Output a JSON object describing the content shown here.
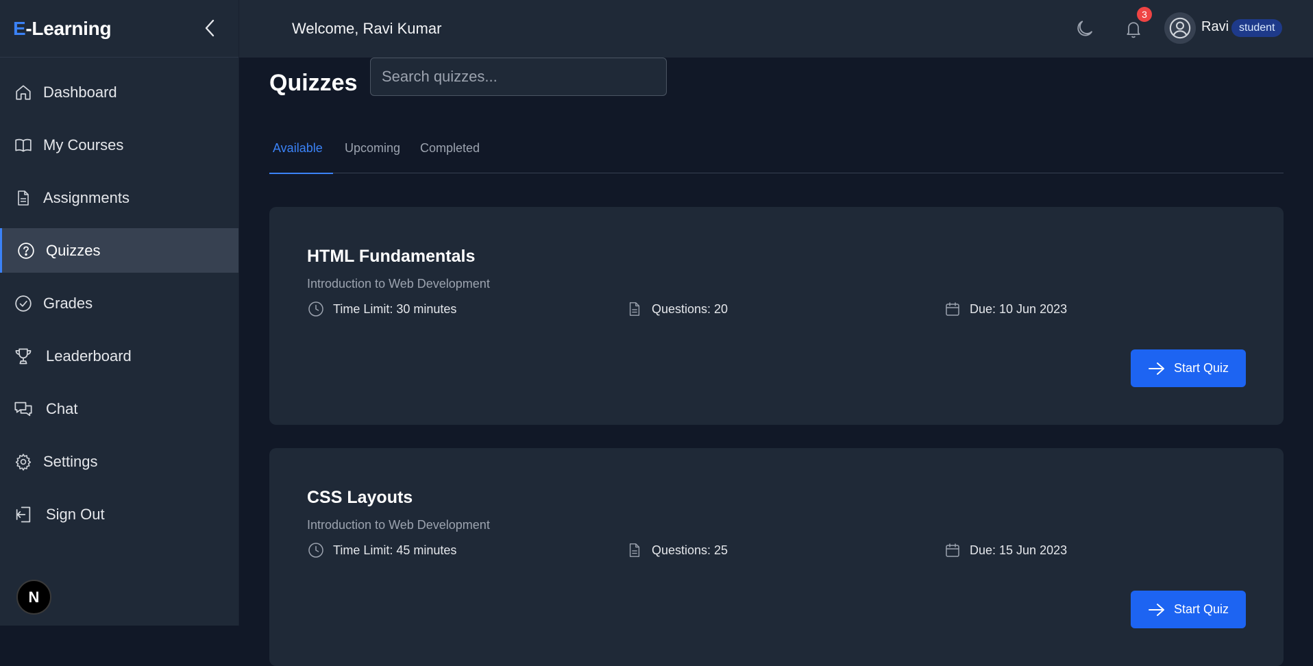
{
  "app": {
    "logo_accent": "E",
    "logo_rest": "-Learning",
    "accent_color": "#3b82f6"
  },
  "header": {
    "welcome": "Welcome, Ravi Kumar",
    "notification_count": "3",
    "username": "Ravi",
    "role": "student"
  },
  "sidebar": {
    "items": [
      {
        "label": "Dashboard",
        "icon": "home-icon"
      },
      {
        "label": "My Courses",
        "icon": "book-icon"
      },
      {
        "label": "Assignments",
        "icon": "document-icon"
      },
      {
        "label": "Quizzes",
        "icon": "question-circle-icon",
        "active": true
      },
      {
        "label": "Grades",
        "icon": "check-circle-icon"
      },
      {
        "label": "Leaderboard",
        "icon": "trophy-icon"
      },
      {
        "label": "Chat",
        "icon": "chat-icon"
      },
      {
        "label": "Settings",
        "icon": "gear-icon"
      },
      {
        "label": "Sign Out",
        "icon": "sign-out-icon"
      }
    ],
    "footer_badge": "N"
  },
  "main": {
    "title": "Quizzes",
    "search_placeholder": "Search quizzes...",
    "tabs": [
      {
        "label": "Available",
        "active": true
      },
      {
        "label": "Upcoming"
      },
      {
        "label": "Completed"
      }
    ],
    "quizzes": [
      {
        "title": "HTML Fundamentals",
        "course": "Introduction to Web Development",
        "time_limit": "Time Limit: 30 minutes",
        "questions": "Questions: 20",
        "due": "Due: 10 Jun 2023",
        "button": "Start Quiz"
      },
      {
        "title": "CSS Layouts",
        "course": "Introduction to Web Development",
        "time_limit": "Time Limit: 45 minutes",
        "questions": "Questions: 25",
        "due": "Due: 15 Jun 2023",
        "button": "Start Quiz"
      }
    ]
  }
}
